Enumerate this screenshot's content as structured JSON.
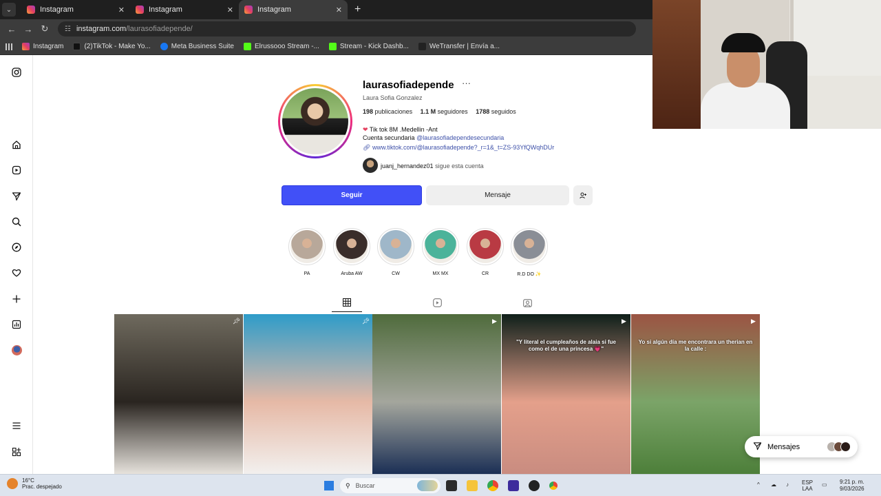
{
  "browser": {
    "tabs": [
      {
        "title": "Instagram"
      },
      {
        "title": "Instagram"
      },
      {
        "title": "Instagram"
      }
    ],
    "url_host": "instagram.com",
    "url_path": "/laurasofiadepende/",
    "bookmarks": [
      {
        "label": "Instagram",
        "color": "#e4405f"
      },
      {
        "label": "(2)TikTok - Make Yo...",
        "color": "#111111"
      },
      {
        "label": "Meta Business Suite",
        "color": "#1877f2"
      },
      {
        "label": "Elrussooo Stream -...",
        "color": "#53fc18"
      },
      {
        "label": "Stream - Kick Dashb...",
        "color": "#53fc18"
      },
      {
        "label": "WeTransfer | Envía a...",
        "color": "#222222"
      }
    ]
  },
  "sidebar": {
    "icons": [
      "instagram-logo-icon",
      "home-icon",
      "reels-icon",
      "send-icon",
      "search-icon",
      "explore-icon",
      "heart-icon",
      "create-icon",
      "dashboard-icon",
      "profile-avatar-icon",
      "menu-icon",
      "apps-icon"
    ]
  },
  "profile": {
    "username": "laurasofiadepende",
    "full_name": "Laura Sofia Gonzalez",
    "posts_count": "198",
    "posts_label": "publicaciones",
    "followers_count": "1.1 M",
    "followers_label": "seguidores",
    "following_count": "1788",
    "following_label": "seguidos",
    "bio_line1": "Tik tok 8M .Medellin -Ant",
    "bio_line2_prefix": "Cuenta secundaria",
    "bio_line2_link": "@laurasofiadependesecundaria",
    "bio_url": "www.tiktok.com/@laurasofiadepende?_r=1&_t=ZS-93YfQWqhDUr",
    "followed_by_user": "juanj_hernandez01",
    "followed_by_text": "sigue esta cuenta",
    "follow_button": "Seguir",
    "message_button": "Mensaje"
  },
  "highlights": [
    {
      "label": "PA",
      "color": "#b8a89a"
    },
    {
      "label": "Aruba AW",
      "color": "#3a2d2a"
    },
    {
      "label": "CW",
      "color": "#9fb7c9"
    },
    {
      "label": "MX MX",
      "color": "#4bb39a"
    },
    {
      "label": "CR",
      "color": "#b93a43"
    },
    {
      "label": "R.D DO ✨",
      "color": "#8a8e96"
    }
  ],
  "posts": [
    {
      "caption": "",
      "badge": "pin-icon",
      "colors": [
        "#6f6a5e",
        "#2a2520",
        "#e6e2dc"
      ]
    },
    {
      "caption": "",
      "badge": "pin-icon",
      "colors": [
        "#2e9cc9",
        "#e6b9a6",
        "#f2f0ee"
      ]
    },
    {
      "caption": "",
      "badge": "reel-icon",
      "colors": [
        "#4f6b3c",
        "#a4a69d",
        "#1b2f55"
      ]
    },
    {
      "caption": "\"Y literal el cumpleaños de alaia si fue como el de una princesa 💗\"",
      "badge": "reel-icon",
      "colors": [
        "#0f1f1a",
        "#e4a08b",
        "#c98c80"
      ]
    },
    {
      "caption": "Yo si algún día me encontrara un therian en la calle :",
      "badge": "reel-icon",
      "colors": [
        "#9b5443",
        "#7ba468",
        "#4d7f3a"
      ]
    }
  ],
  "messages": {
    "label": "Mensajes"
  },
  "taskbar": {
    "temp": "16°C",
    "weather_text": "Prac. despejado",
    "search_placeholder": "Buscar",
    "lang_top": "ESP",
    "lang_bottom": "LAA",
    "time": "9:21 p. m.",
    "date": "9/03/2026"
  }
}
